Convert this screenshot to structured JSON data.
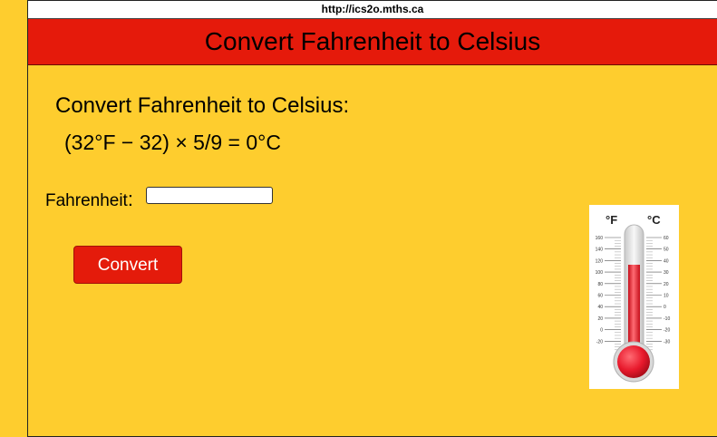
{
  "browser": {
    "url": "http://ics2o.mths.ca"
  },
  "header": {
    "title": "Convert Fahrenheit to Celsius"
  },
  "main": {
    "heading": "Convert Fahrenheit to Celsius:",
    "formula": "(32°F − 32) × 5/9 = 0°C",
    "fahrenheit_label": "Fahrenheit",
    "fahrenheit_colon": ":",
    "fahrenheit_value": "",
    "convert_button": "Convert"
  },
  "thermometer": {
    "icon": "thermometer-icon",
    "f_unit": "°F",
    "c_unit": "°C",
    "f_ticks": [
      "160",
      "140",
      "120",
      "100",
      "80",
      "60",
      "40",
      "20",
      "0",
      "-20"
    ],
    "c_ticks": [
      "60",
      "50",
      "40",
      "30",
      "20",
      "10",
      "0",
      "-10",
      "-20",
      "-30"
    ],
    "fill_color": "#e8192c"
  },
  "colors": {
    "background": "#fecd2e",
    "header": "#e51a0b",
    "button": "#e41b0b"
  }
}
